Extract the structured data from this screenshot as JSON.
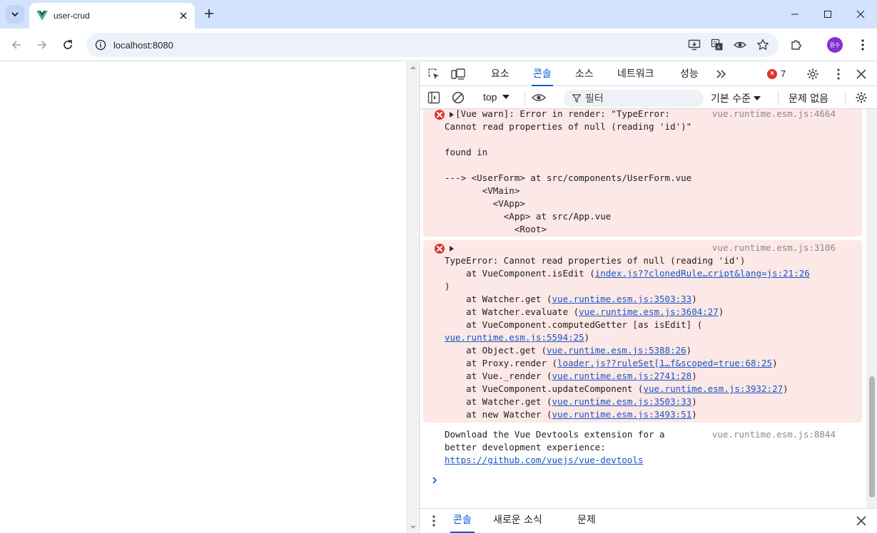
{
  "browser": {
    "tab_title": "user-crud",
    "url": "localhost:8080",
    "profile_initials": "원수"
  },
  "devtools": {
    "tabs": [
      {
        "label": "요소"
      },
      {
        "label": "콘솔",
        "active": true
      },
      {
        "label": "소스"
      },
      {
        "label": "네트워크"
      },
      {
        "label": "성능"
      }
    ],
    "error_count": "7",
    "context": "top",
    "filter_placeholder": "필터",
    "levels_label": "기본 수준",
    "issues_label": "문제 없음"
  },
  "console": {
    "messages": [
      {
        "type": "error",
        "source": "vue.runtime.esm.js:4664",
        "lines": [
          "[Vue warn]: Error in render: \"TypeError:",
          "Cannot read properties of null (reading 'id')\"",
          "",
          "found in",
          "",
          "---> <UserForm> at src/components/UserForm.vue",
          "       <VMain>",
          "         <VApp>",
          "           <App> at src/App.vue",
          "             <Root>"
        ]
      },
      {
        "type": "error",
        "source": "vue.runtime.esm.js:3106",
        "message": "TypeError: Cannot read properties of null (reading 'id')",
        "stack": [
          {
            "prefix": "    at VueComponent.isEdit (",
            "link": "index.js??clonedRule…cript&lang=js:21:26",
            "suffix": ""
          },
          {
            "prefix": ")",
            "link": "",
            "suffix": ""
          },
          {
            "prefix": "    at Watcher.get (",
            "link": "vue.runtime.esm.js:3503:33",
            "suffix": ")"
          },
          {
            "prefix": "    at Watcher.evaluate (",
            "link": "vue.runtime.esm.js:3604:27",
            "suffix": ")"
          },
          {
            "prefix": "    at VueComponent.computedGetter [as isEdit] (",
            "link": "",
            "suffix": ""
          },
          {
            "prefix": "",
            "link": "vue.runtime.esm.js:5594:25",
            "suffix": ")"
          },
          {
            "prefix": "    at Object.get (",
            "link": "vue.runtime.esm.js:5388:26",
            "suffix": ")"
          },
          {
            "prefix": "    at Proxy.render (",
            "link": "loader.js??ruleSet[1…f&scoped=true:68:25",
            "suffix": ")"
          },
          {
            "prefix": "    at Vue._render (",
            "link": "vue.runtime.esm.js:2741:28",
            "suffix": ")"
          },
          {
            "prefix": "    at VueComponent.updateComponent (",
            "link": "vue.runtime.esm.js:3932:27",
            "suffix": ")"
          },
          {
            "prefix": "    at Watcher.get (",
            "link": "vue.runtime.esm.js:3503:33",
            "suffix": ")"
          },
          {
            "prefix": "    at new Watcher (",
            "link": "vue.runtime.esm.js:3493:51",
            "suffix": ")"
          }
        ]
      },
      {
        "type": "info",
        "source": "vue.runtime.esm.js:8844",
        "lines": [
          "Download the Vue Devtools extension for a",
          "better development experience:"
        ],
        "link": "https://github.com/vuejs/vue-devtools"
      }
    ]
  },
  "drawer": {
    "tabs": [
      {
        "label": "콘솔",
        "active": true
      },
      {
        "label": "새로운 소식"
      },
      {
        "label": "문제"
      }
    ]
  },
  "colors": {
    "accent": "#0b57d0",
    "error_bg": "#fce8e6",
    "error_icon": "#dc362e",
    "link": "#1a55c5"
  }
}
